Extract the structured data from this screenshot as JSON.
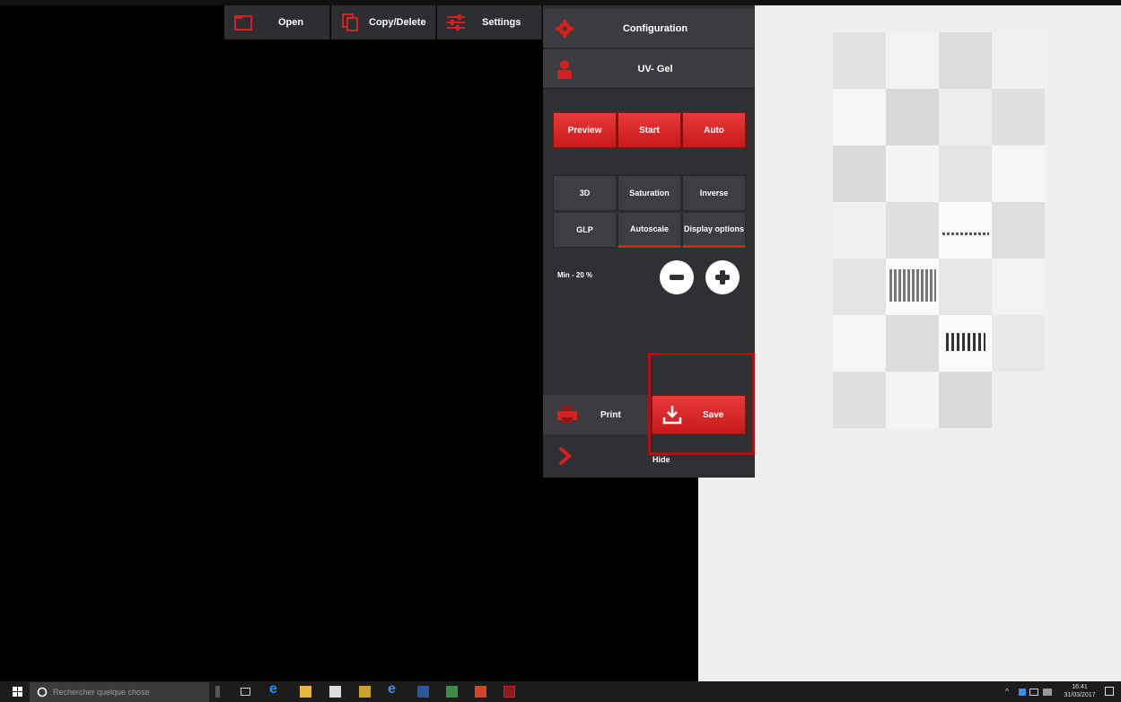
{
  "toolbar": {
    "open_label": "Open",
    "copy_delete_label": "Copy/Delete",
    "settings_label": "Settings"
  },
  "panel": {
    "configuration_label": "Configuration",
    "mode_label": "UV- Gel",
    "actions": {
      "preview": "Preview",
      "start": "Start",
      "auto": "Auto"
    },
    "options": {
      "three_d": "3D",
      "saturation": "Saturation",
      "inverse": "Inverse",
      "glp": "GLP",
      "autoscale": "Autoscale",
      "display_options": "Display options"
    },
    "min_label": "Min - 20 %",
    "print_label": "Print",
    "save_label": "Save",
    "hide_label": "Hide"
  },
  "taskbar": {
    "search_placeholder": "Rechercher quelque chose",
    "time": "16:41",
    "date": "31/03/2017"
  },
  "colors": {
    "accent_red": "#d62020",
    "panel_bg": "#2e3033",
    "gallery_bg": "#efefef",
    "highlight_box": "#b01010"
  }
}
